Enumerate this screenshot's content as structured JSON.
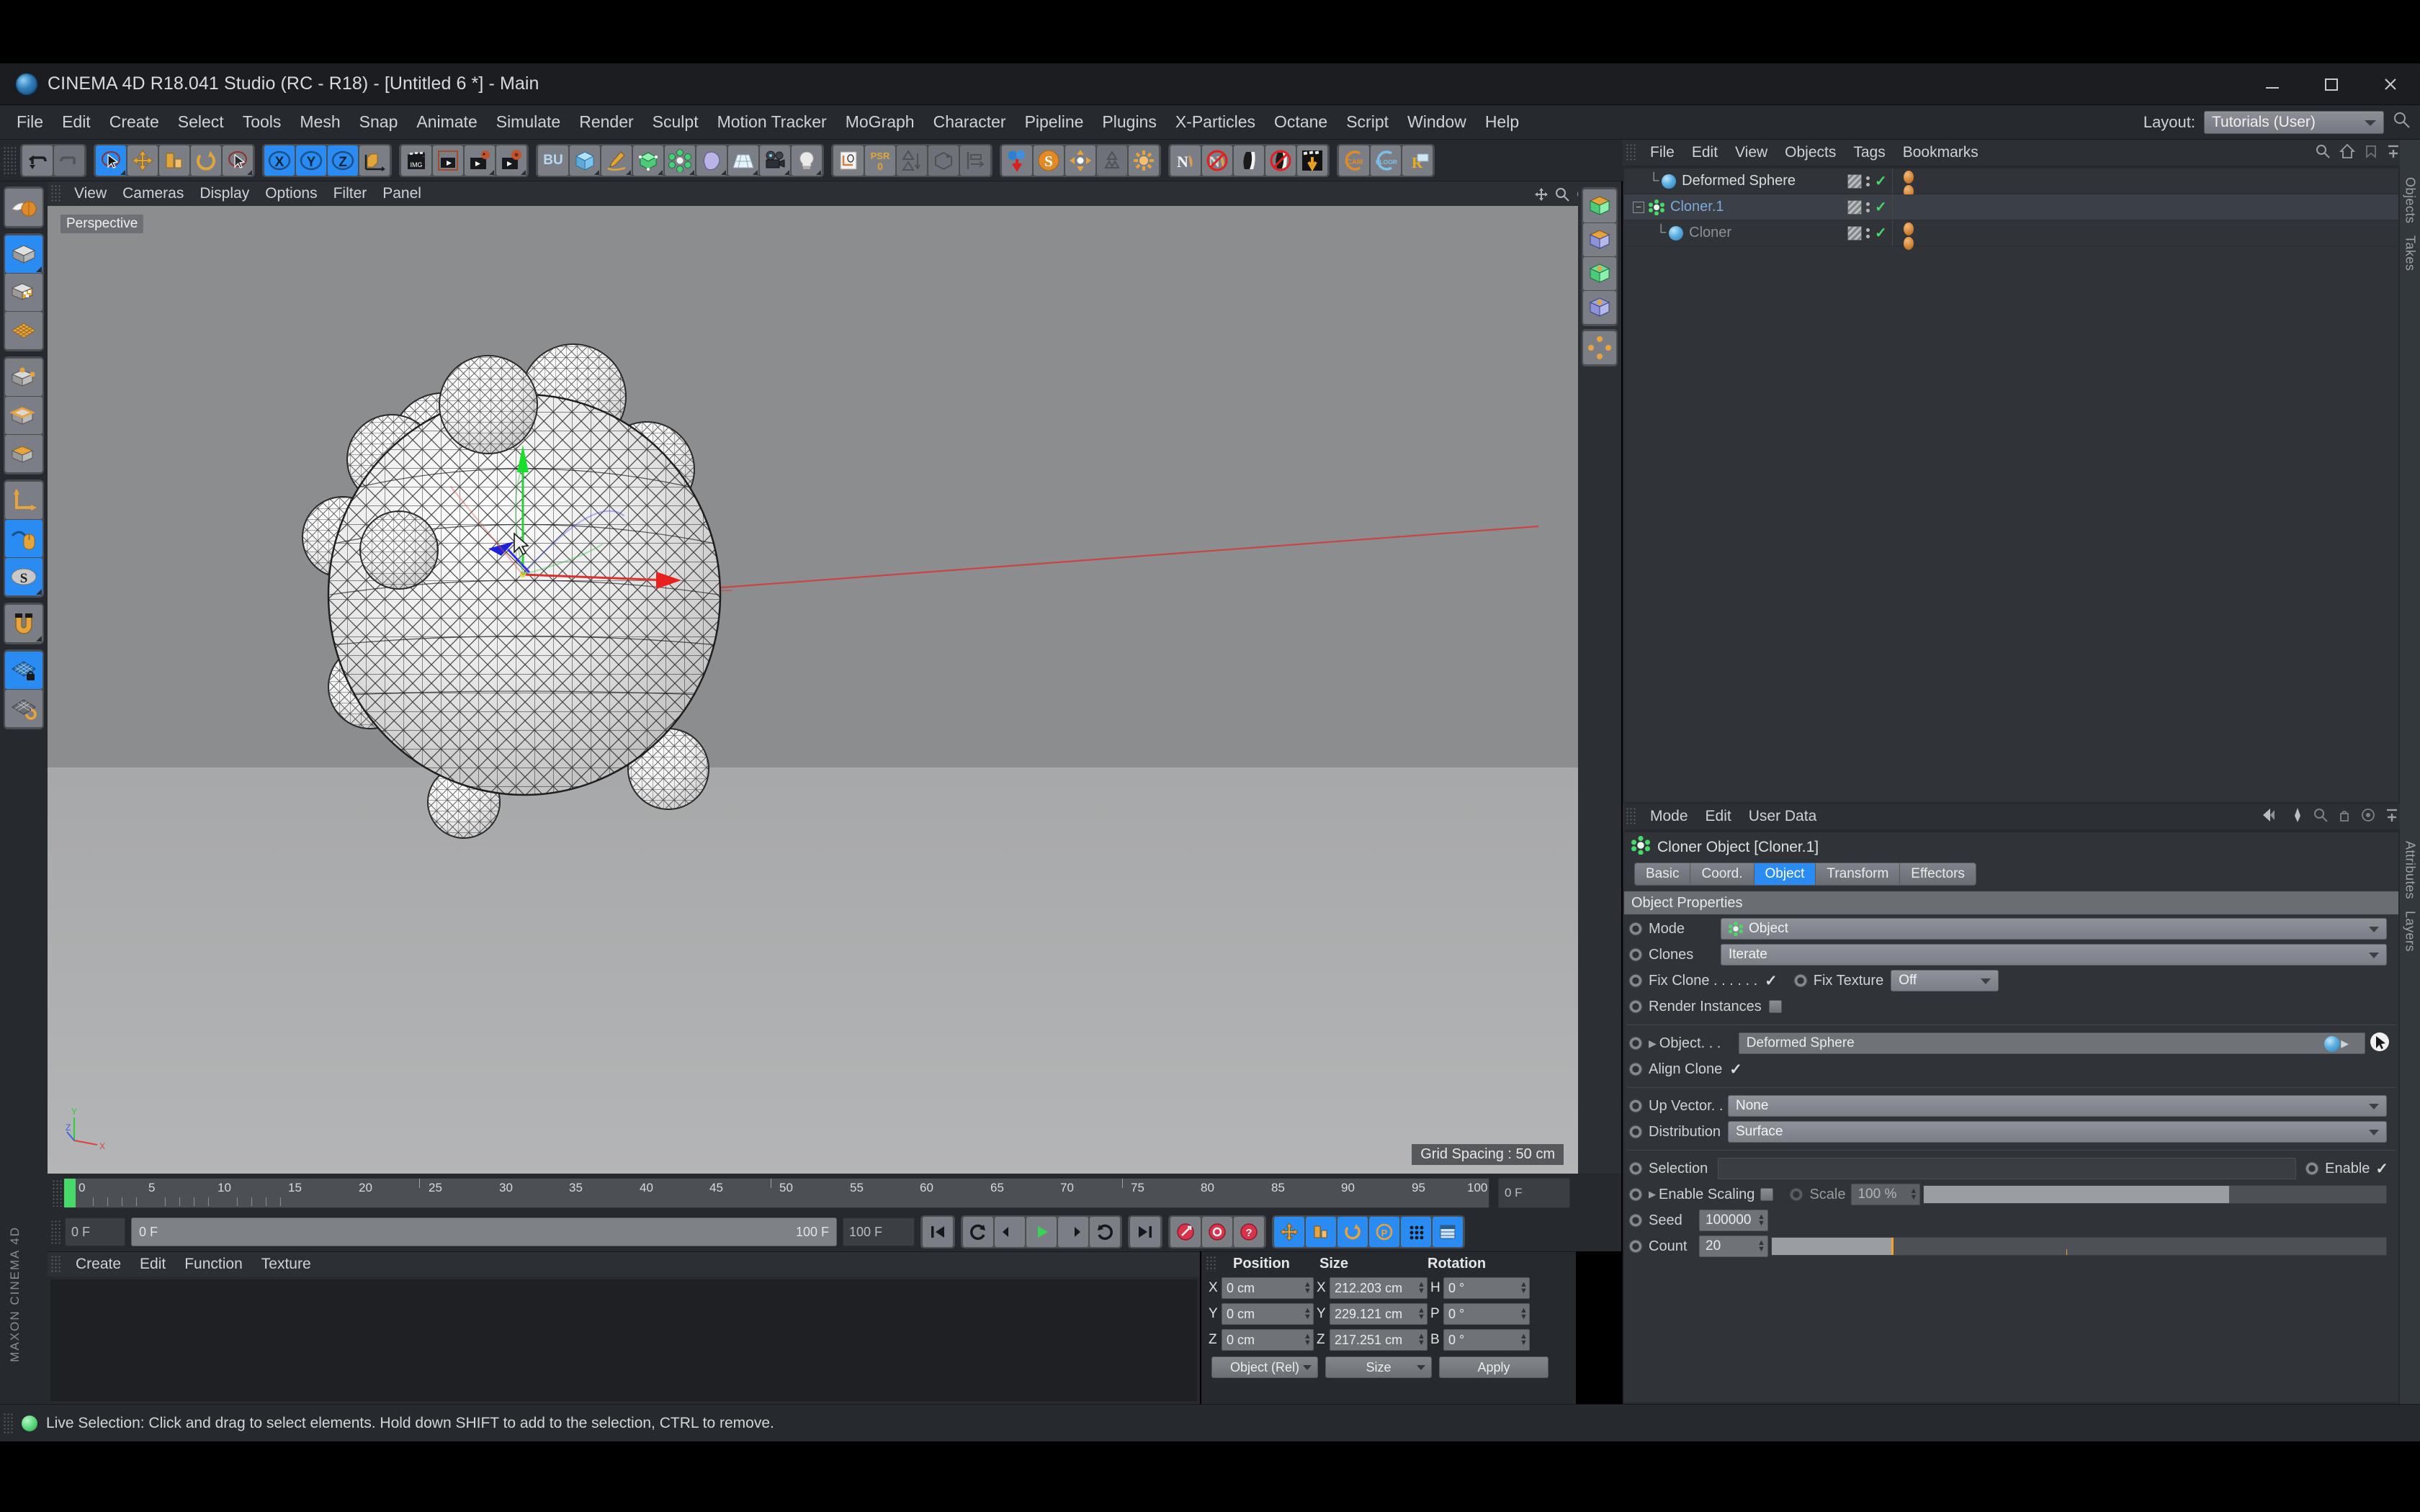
{
  "window": {
    "title": "CINEMA 4D R18.041 Studio (RC - R18) - [Untitled 6 *] - Main",
    "app_icon": "cinema4d-logo-icon",
    "minimize_label": "Minimize",
    "maximize_label": "Maximize",
    "close_label": "Close"
  },
  "menubar": {
    "items": [
      "File",
      "Edit",
      "Create",
      "Select",
      "Tools",
      "Mesh",
      "Snap",
      "Animate",
      "Simulate",
      "Render",
      "Sculpt",
      "Motion Tracker",
      "MoGraph",
      "Character",
      "Pipeline",
      "Plugins",
      "X-Particles",
      "Octane",
      "Script",
      "Window",
      "Help"
    ],
    "layout_label": "Layout:",
    "layout_value": "Tutorials (User)"
  },
  "toolbar": {
    "groups": [
      {
        "buttons": [
          {
            "name": "undo-button",
            "icon": "undo-arrow-icon",
            "state": "normal"
          },
          {
            "name": "redo-button",
            "icon": "redo-arrow-icon",
            "state": "disabled"
          }
        ]
      },
      {
        "buttons": [
          {
            "name": "live-selection-tool",
            "icon": "arrow-select-icon",
            "state": "active"
          },
          {
            "name": "move-tool",
            "icon": "move-cross-icon",
            "state": "normal"
          },
          {
            "name": "scale-tool",
            "icon": "scale-box-icon",
            "state": "normal"
          },
          {
            "name": "rotate-tool",
            "icon": "rotate-circle-icon",
            "state": "normal"
          },
          {
            "name": "selection-tool-extra",
            "icon": "arrow-select-icon",
            "state": "normal"
          }
        ]
      },
      {
        "buttons": [
          {
            "name": "axis-x-toggle",
            "icon": "x-axis-icon",
            "label": "X",
            "state": "active"
          },
          {
            "name": "axis-y-toggle",
            "icon": "y-axis-icon",
            "label": "Y",
            "state": "active"
          },
          {
            "name": "axis-z-toggle",
            "icon": "z-axis-icon",
            "label": "Z",
            "state": "active"
          },
          {
            "name": "world-object-coordinate-toggle",
            "icon": "world-axis-icon",
            "state": "normal"
          }
        ]
      },
      {
        "buttons": [
          {
            "name": "render-view-button",
            "icon": "clapperboard-icon",
            "state": "normal"
          },
          {
            "name": "render-region-button",
            "icon": "render-region-icon",
            "state": "normal"
          },
          {
            "name": "render-to-picture-viewer-button",
            "icon": "render-picture-icon",
            "state": "normal"
          },
          {
            "name": "render-settings-button",
            "icon": "render-settings-icon",
            "state": "normal"
          }
        ]
      },
      {
        "buttons": [
          {
            "name": "bu-content-browser-button",
            "icon": "bu-icon",
            "label": "BU",
            "state": "normal"
          },
          {
            "name": "add-cube-button",
            "icon": "cube-icon",
            "state": "normal"
          },
          {
            "name": "spline-pen-button",
            "icon": "pen-spline-icon",
            "state": "normal"
          },
          {
            "name": "generator-button",
            "icon": "green-cube-icon",
            "state": "normal"
          },
          {
            "name": "mograph-button",
            "icon": "cloner-green-icon",
            "state": "normal"
          },
          {
            "name": "deformer-button",
            "icon": "bend-deformer-icon",
            "state": "normal"
          },
          {
            "name": "environment-button",
            "icon": "floor-grid-icon",
            "state": "normal"
          },
          {
            "name": "camera-button",
            "icon": "camera-icon",
            "state": "normal"
          },
          {
            "name": "light-button",
            "icon": "light-bulb-icon",
            "state": "normal"
          }
        ]
      },
      {
        "buttons": [
          {
            "name": "layout-manager-button",
            "icon": "layout-edit-icon",
            "state": "normal"
          },
          {
            "name": "psr-button",
            "icon": "psr-icon",
            "label": "PSR",
            "sub": "0",
            "state": "normal"
          },
          {
            "name": "polygon-reduction-button",
            "icon": "triangle-icon",
            "state": "disabled"
          },
          {
            "name": "connect-button",
            "icon": "connect-box-icon",
            "state": "disabled"
          },
          {
            "name": "align-button",
            "icon": "align-icon",
            "state": "disabled"
          }
        ]
      },
      {
        "buttons": [
          {
            "name": "drop-to-floor-button",
            "icon": "spheres-drop-icon",
            "state": "normal"
          },
          {
            "name": "scatter-button",
            "icon": "orange-s-icon",
            "state": "normal"
          },
          {
            "name": "center-button",
            "icon": "center-arrows-icon",
            "state": "normal"
          },
          {
            "name": "recycle-button",
            "icon": "recycle-icon",
            "state": "disabled"
          },
          {
            "name": "sunburst-button",
            "icon": "sunburst-icon",
            "state": "normal"
          }
        ]
      },
      {
        "buttons": [
          {
            "name": "normals-button",
            "icon": "n-normals-icon",
            "state": "normal"
          },
          {
            "name": "normals-off-button",
            "icon": "n-normals-off-icon",
            "state": "normal"
          },
          {
            "name": "shading-button",
            "icon": "shading-icon",
            "state": "normal"
          },
          {
            "name": "shading-off-button",
            "icon": "shading-off-icon",
            "state": "normal"
          },
          {
            "name": "anchor-button",
            "icon": "anchor-clapper-icon",
            "state": "normal"
          }
        ]
      },
      {
        "buttons": [
          {
            "name": "cam-button",
            "icon": "cam-ring-icon",
            "label": "CAM",
            "state": "normal"
          },
          {
            "name": "floor-button",
            "icon": "floor-ring-icon",
            "label": "FLOOR",
            "state": "normal"
          },
          {
            "name": "r-button",
            "icon": "r-flag-icon",
            "label": "R",
            "state": "normal"
          }
        ]
      }
    ]
  },
  "left_toolbar": {
    "groups": [
      {
        "buttons": [
          {
            "name": "live-selection-modes-button",
            "icon": "selection-sphere-icon",
            "state": "normal"
          }
        ]
      },
      {
        "buttons": [
          {
            "name": "model-mode-button",
            "icon": "model-cube-icon",
            "state": "active"
          },
          {
            "name": "texture-mode-button",
            "icon": "texture-cube-icon",
            "state": "normal"
          },
          {
            "name": "workplane-mode-button",
            "icon": "workplane-grid-icon",
            "state": "normal"
          }
        ]
      },
      {
        "buttons": [
          {
            "name": "points-mode-button",
            "icon": "points-cube-icon",
            "state": "normal"
          },
          {
            "name": "edges-mode-button",
            "icon": "edges-cube-icon",
            "state": "normal"
          },
          {
            "name": "polygons-mode-button",
            "icon": "polygons-cube-icon",
            "state": "normal"
          }
        ]
      },
      {
        "buttons": [
          {
            "name": "object-axis-mode-button",
            "icon": "axis-l-icon",
            "state": "normal"
          },
          {
            "name": "enable-axis-modification-button",
            "icon": "mouse-axis-icon",
            "state": "active"
          },
          {
            "name": "viewport-solo-button",
            "icon": "solo-s-icon",
            "state": "active"
          }
        ]
      },
      {
        "buttons": [
          {
            "name": "magnet-tool-button",
            "icon": "magnet-icon",
            "state": "normal"
          }
        ]
      },
      {
        "buttons": [
          {
            "name": "lock-workplane-button",
            "icon": "workplane-lock-icon",
            "state": "active"
          },
          {
            "name": "planar-workplane-button",
            "icon": "workplane-rotate-icon",
            "state": "normal"
          }
        ]
      }
    ],
    "brand_line1": "MAXON",
    "brand_line2": "CINEMA 4D"
  },
  "viewport": {
    "menu_items": [
      "View",
      "Cameras",
      "Display",
      "Options",
      "Filter",
      "Panel"
    ],
    "view_tag": "Perspective",
    "grid_spacing": "Grid Spacing : 50 cm",
    "axis_labels": {
      "x": "X",
      "y": "Y",
      "z": "Z"
    },
    "scene": {
      "description": "Wireframe deformed sphere with 20 smaller sphere clones distributed on its surface",
      "clone_count": 20,
      "background_top": "#8c8d8e",
      "background_bottom": "#b4b5b6"
    },
    "right_buttons": [
      {
        "name": "viewport-green-cube-1",
        "icon": "green-cube-icon"
      },
      {
        "name": "viewport-blue-cube-1",
        "icon": "blue-cube-icon"
      },
      {
        "name": "viewport-green-cube-2",
        "icon": "green-cube-dot-icon"
      },
      {
        "name": "viewport-blue-cube-2",
        "icon": "blue-cube-dot-icon"
      },
      {
        "name": "viewport-lights-button",
        "icon": "four-lights-icon"
      }
    ]
  },
  "timeline": {
    "ticks": [
      "0",
      "5",
      "10",
      "15",
      "20",
      "25",
      "30",
      "35",
      "40",
      "45",
      "50",
      "55",
      "60",
      "65",
      "70",
      "75",
      "80",
      "85",
      "90",
      "95",
      "100"
    ],
    "end_frame_box": "0 F",
    "current_frame": "0 F",
    "range_start": "0 F",
    "range_end": "100 F",
    "max_frame": "100 F",
    "transport": [
      {
        "name": "go-to-start-button",
        "icon": "skip-start-icon"
      },
      {
        "name": "play-reverse-loop-button",
        "icon": "loop-back-icon"
      },
      {
        "name": "previous-frame-button",
        "icon": "step-back-icon"
      },
      {
        "name": "play-button",
        "icon": "play-triangle-icon"
      },
      {
        "name": "next-frame-button",
        "icon": "step-forward-icon"
      },
      {
        "name": "play-forward-loop-button",
        "icon": "loop-forward-icon"
      },
      {
        "name": "go-to-end-button",
        "icon": "skip-end-icon"
      }
    ],
    "record_buttons": [
      {
        "name": "record-active-objects-button",
        "icon": "record-red-icon"
      },
      {
        "name": "autokeying-button",
        "icon": "autokey-red-icon"
      },
      {
        "name": "keyframe-selection-button",
        "icon": "key-question-icon"
      }
    ],
    "key_toggles": [
      {
        "name": "position-key-toggle",
        "icon": "position-cross-icon",
        "state": "active"
      },
      {
        "name": "scale-key-toggle",
        "icon": "scale-key-icon",
        "state": "active"
      },
      {
        "name": "rotation-key-toggle",
        "icon": "rotation-key-icon",
        "state": "active"
      },
      {
        "name": "parameter-key-toggle",
        "icon": "param-p-icon",
        "state": "active"
      },
      {
        "name": "point-level-animation-toggle",
        "icon": "pla-dots-icon",
        "state": "active"
      },
      {
        "name": "timeline-layout-button",
        "icon": "timeline-panel-icon",
        "state": "active"
      }
    ]
  },
  "material_manager": {
    "menu_items": [
      "Create",
      "Edit",
      "Function",
      "Texture"
    ],
    "materials": []
  },
  "coordinates": {
    "headers": [
      "Position",
      "Size",
      "Rotation"
    ],
    "rows": [
      {
        "pos_label": "X",
        "pos_value": "0 cm",
        "size_label": "X",
        "size_value": "212.203 cm",
        "rot_label": "H",
        "rot_value": "0 °"
      },
      {
        "pos_label": "Y",
        "pos_value": "0 cm",
        "size_label": "Y",
        "size_value": "229.121 cm",
        "rot_label": "P",
        "rot_value": "0 °"
      },
      {
        "pos_label": "Z",
        "pos_value": "0 cm",
        "size_label": "Z",
        "size_value": "217.251 cm",
        "rot_label": "B",
        "rot_value": "0 °"
      }
    ],
    "mode_select": "Object (Rel)",
    "size_select": "Size",
    "apply_button": "Apply"
  },
  "object_manager": {
    "menu_items": [
      "File",
      "Edit",
      "View",
      "Objects",
      "Tags",
      "Bookmarks"
    ],
    "rows": [
      {
        "name": "Deformed Sphere",
        "icon": "sphere-object-icon",
        "indent": 1,
        "color": "white",
        "selected": false,
        "has_material_tags": true,
        "expandable": false
      },
      {
        "name": "Cloner.1",
        "icon": "cloner-object-icon",
        "indent": 0,
        "color": "blue",
        "selected": true,
        "has_material_tags": false,
        "expandable": true
      },
      {
        "name": "Cloner",
        "icon": "sphere-object-icon",
        "indent": 1,
        "color": "grey",
        "selected": false,
        "has_material_tags": true,
        "expandable": false
      }
    ],
    "side_tabs": [
      "Objects",
      "Takes"
    ]
  },
  "attribute_manager": {
    "menu_items": [
      "Mode",
      "Edit",
      "User Data"
    ],
    "object_title": "Cloner Object [Cloner.1]",
    "object_icon": "cloner-object-icon",
    "tabs": [
      {
        "label": "Basic",
        "active": false
      },
      {
        "label": "Coord.",
        "active": false
      },
      {
        "label": "Object",
        "active": true
      },
      {
        "label": "Transform",
        "active": false
      },
      {
        "label": "Effectors",
        "active": false
      }
    ],
    "section_header": "Object Properties",
    "fields": {
      "mode_label": "Mode",
      "mode_value": "Object",
      "clones_label": "Clones",
      "clones_value": "Iterate",
      "fix_clone_label": "Fix Clone . . . . . .",
      "fix_clone_checked": true,
      "fix_texture_label": "Fix Texture",
      "fix_texture_value": "Off",
      "render_instances_label": "Render Instances",
      "render_instances_checked": false,
      "object_label": "Object. . .",
      "object_value": "Deformed Sphere",
      "align_clone_label": "Align Clone",
      "align_clone_checked": true,
      "up_vector_label": "Up Vector. .",
      "up_vector_value": "None",
      "distribution_label": "Distribution",
      "distribution_value": "Surface",
      "selection_label": "Selection",
      "selection_value": "",
      "enable_label": "Enable",
      "enable_checked": true,
      "enable_scaling_label": "Enable Scaling",
      "enable_scaling_checked": false,
      "scale_label": "Scale",
      "scale_value": "100 %",
      "seed_label": "Seed",
      "seed_value": "100000",
      "count_label": "Count",
      "count_value": "20"
    },
    "side_tabs": [
      "Attributes",
      "Layers"
    ]
  },
  "statusbar": {
    "message": "Live Selection: Click and drag to select elements. Hold down SHIFT to add to the selection, CTRL to remove."
  },
  "colors": {
    "accent_blue": "#2a8bf2",
    "panel_bg": "#262a2e",
    "field_bg": "#6f7378",
    "green_check": "#4bd86a",
    "orange": "#f0a32a"
  }
}
